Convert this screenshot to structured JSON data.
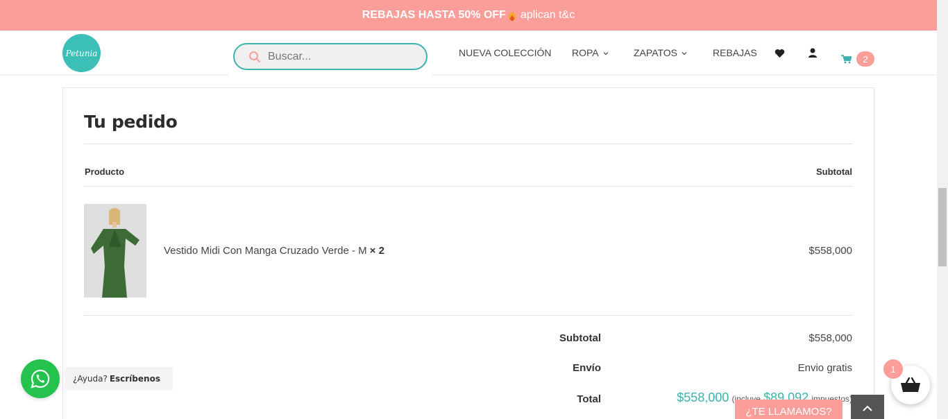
{
  "promo": {
    "bold_text": "REBAJAS HASTA 50% OFF",
    "rest_text": "aplican t&c",
    "color": "#fb9e9a"
  },
  "header": {
    "logo_text": "Petunia",
    "search": {
      "placeholder": "Buscar..."
    },
    "nav": [
      {
        "label": "NUEVA COLECCIÓN"
      },
      {
        "label": "ROPA"
      },
      {
        "label": "ZAPATOS"
      },
      {
        "label": "REBAJAS"
      }
    ],
    "icons": [
      "heart-icon",
      "user-icon",
      "cart-icon"
    ],
    "cart_count": "2"
  },
  "order": {
    "title": "Tu pedido",
    "columns": {
      "product": "Producto",
      "subtotal": "Subtotal"
    },
    "items": [
      {
        "name": "Vestido Midi Con Manga Cruzado Verde - M",
        "qty": "× 2",
        "price": "$558,000"
      }
    ],
    "totals": {
      "subtotal_label": "Subtotal",
      "subtotal_value": "$558,000",
      "shipping_label": "Envío",
      "shipping_value": "Envio gratis",
      "total_label": "Total",
      "total_value": "$558,000",
      "tax_prefix": "(incluye",
      "tax_value": "$89,092",
      "tax_suffix": "impuestos)"
    }
  },
  "whatsapp": {
    "question": "¿Ayuda?",
    "action": "Escríbenos"
  },
  "call_button": "¿TE LLAMAMOS?",
  "basket_count": "1",
  "colors": {
    "accent_teal": "#3bb3ab",
    "accent_pink": "#fb9e9a",
    "whatsapp": "#25c24d"
  }
}
